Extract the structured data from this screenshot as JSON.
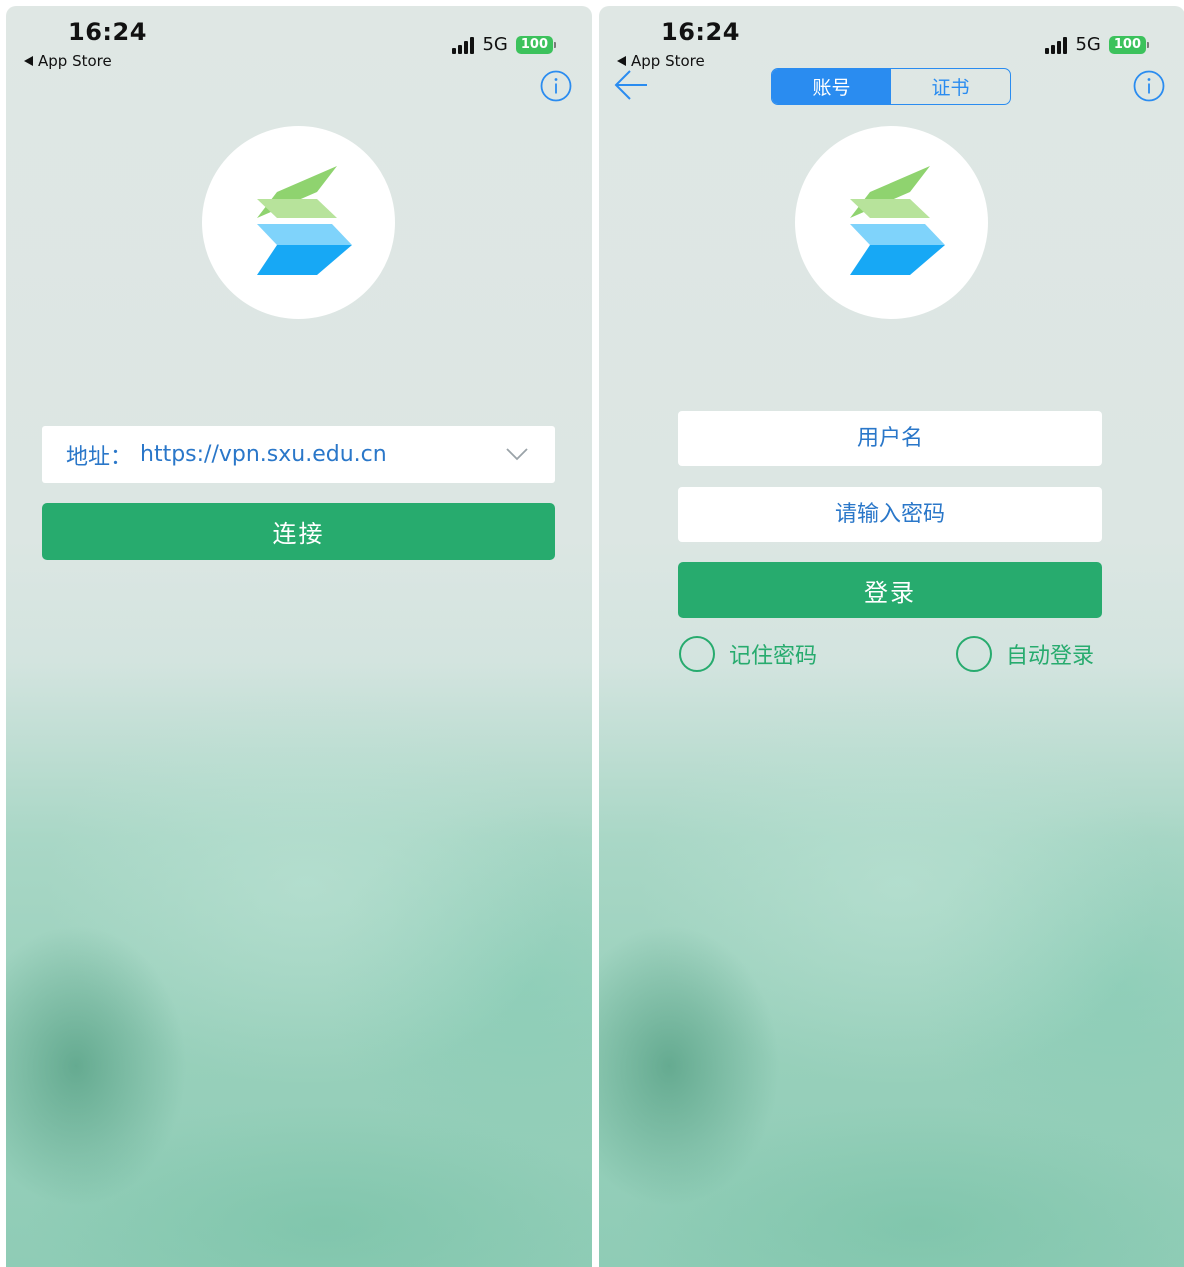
{
  "screens": {
    "left": {
      "status_bar": {
        "time": "16:24",
        "back_app": "App Store",
        "network": "5G",
        "battery": "100"
      },
      "address": {
        "label": "地址：",
        "value": "https://vpn.sxu.edu.cn"
      },
      "connect_label": "连接"
    },
    "right": {
      "status_bar": {
        "time": "16:24",
        "back_app": "App Store",
        "network": "5G",
        "battery": "100"
      },
      "tabs": [
        {
          "label": "账号",
          "active": true
        },
        {
          "label": "证书",
          "active": false
        }
      ],
      "username_placeholder": "用户名",
      "password_placeholder": "请输入密码",
      "login_label": "登录",
      "remember_label": "记住密码",
      "auto_login_label": "自动登录"
    }
  },
  "icons": {
    "info": "info-icon",
    "back": "back-arrow-icon",
    "dropdown": "chevron-down-icon",
    "logo": "app-logo"
  },
  "colors": {
    "primary_green": "#27ab6e",
    "accent_blue": "#2a8cf0",
    "text_blue": "#2a77c9",
    "battery_green": "#3cc25c"
  }
}
